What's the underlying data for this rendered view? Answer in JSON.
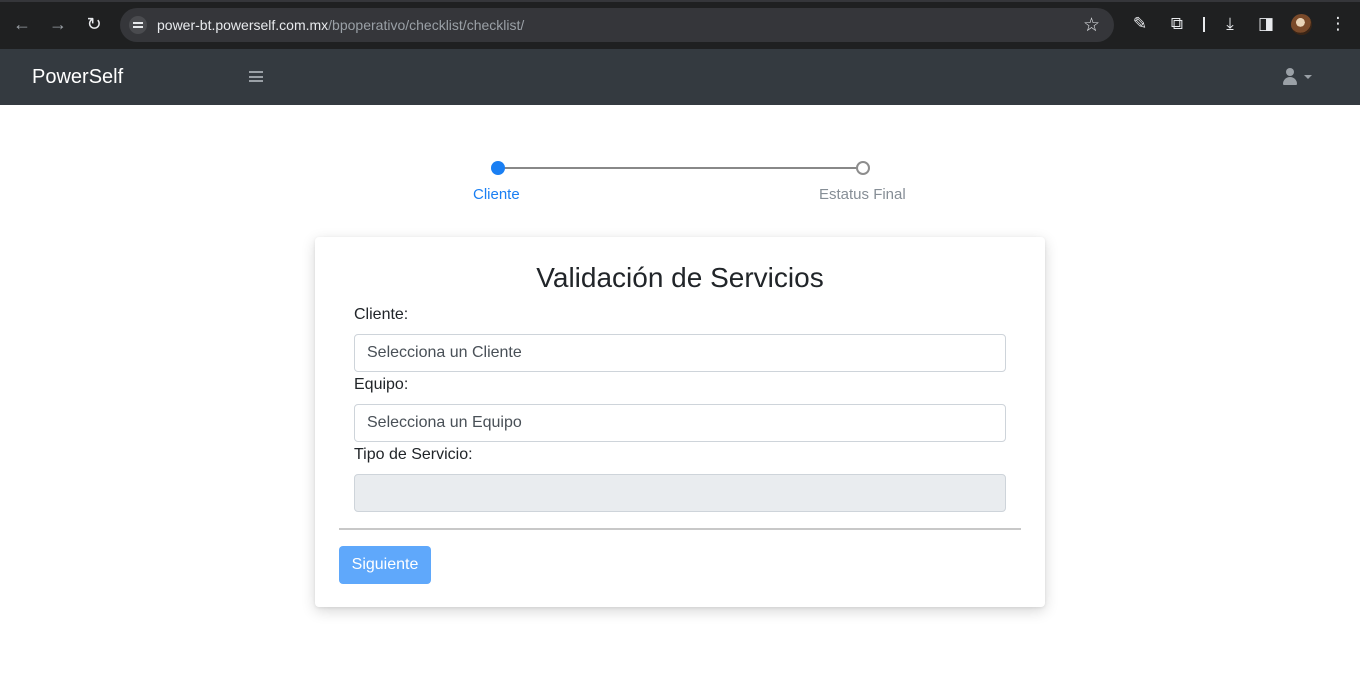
{
  "browser": {
    "url_host": "power-bt.powerself.com.mx",
    "url_path": "/bpoperativo/checklist/checklist/"
  },
  "navbar": {
    "brand": "PowerSelf"
  },
  "stepper": {
    "steps": [
      {
        "label": "Cliente",
        "state": "active"
      },
      {
        "label": "Estatus Final",
        "state": "pending"
      }
    ]
  },
  "form": {
    "title": "Validación de Servicios",
    "fields": [
      {
        "label": "Cliente:",
        "value": "Selecciona un Cliente"
      },
      {
        "label": "Equipo:",
        "value": "Selecciona un Equipo"
      },
      {
        "label": "Tipo de Servicio:",
        "value": ""
      }
    ],
    "next_label": "Siguiente"
  },
  "colors": {
    "primary": "#1a7ff3",
    "button": "#5fa8fb",
    "navbar": "#343a40",
    "disabled_field": "#e9ecef"
  }
}
